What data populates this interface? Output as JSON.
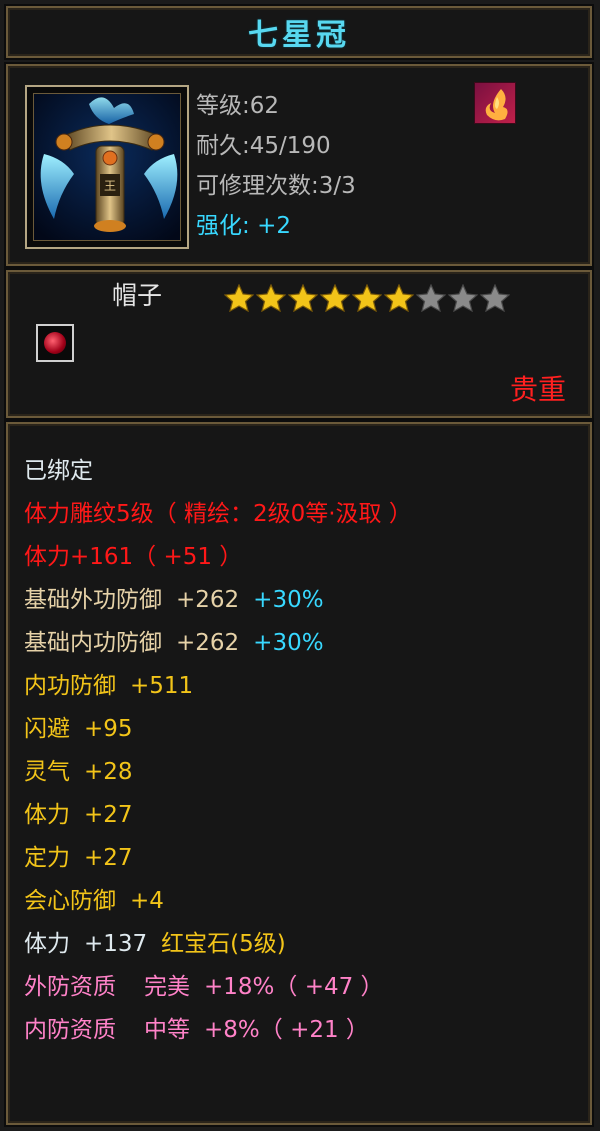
{
  "title": "七星冠",
  "info": {
    "level": "等级:62",
    "durability": "耐久:45/190",
    "repair": "可修理次数:3/3",
    "enhance_label": "强化:",
    "enhance_value": "+2"
  },
  "item_type": "帽子",
  "stars": {
    "filled": 6,
    "total": 9,
    "filled_color": "#f2c419",
    "empty_color": "#8a8a8a"
  },
  "rarity": "贵重",
  "stats": {
    "bound": "已绑定",
    "engrave": "体力雕纹5级（ 精绘：2级0等·汲取 ）",
    "vit_bonus": "体力+161（ +51 ）",
    "base_ext_def": {
      "label": "基础外功防御",
      "value": "+262",
      "pct": "+30%"
    },
    "base_int_def": {
      "label": "基础内功防御",
      "value": "+262",
      "pct": "+30%"
    },
    "int_def": {
      "label": "内功防御",
      "value": "+511"
    },
    "dodge": {
      "label": "闪避",
      "value": "+95"
    },
    "spirit": {
      "label": "灵气",
      "value": "+28"
    },
    "vit": {
      "label": "体力",
      "value": "+27"
    },
    "focus": {
      "label": "定力",
      "value": "+27"
    },
    "crit_def": {
      "label": "会心防御",
      "value": "+4"
    },
    "gem": {
      "label": "体力",
      "value": "+137",
      "gem": "红宝石(5级)"
    },
    "ext_quality": {
      "label": "外防资质",
      "grade": "完美",
      "value": "+18%（ +47 ）"
    },
    "int_quality": {
      "label": "内防资质",
      "grade": "中等",
      "value": "+8%（ +21 ）"
    }
  }
}
